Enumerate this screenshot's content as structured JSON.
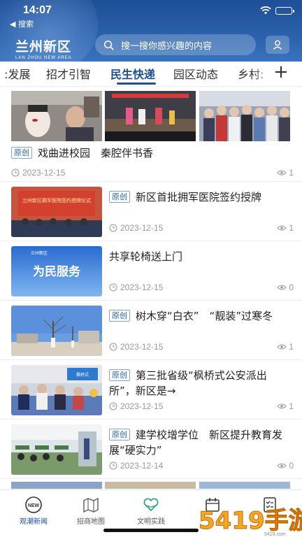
{
  "status_bar": {
    "time": "14:07",
    "back_label": "◀ 搜索"
  },
  "header": {
    "logo_main": "兰州新区",
    "logo_sub": "LAN ZHOU NEW AREA",
    "search_placeholder": "搜一搜你感兴趣的内容",
    "accent_color": "#1e4f97"
  },
  "tabs": {
    "items": [
      {
        "label": ":发展"
      },
      {
        "label": "招才引智"
      },
      {
        "label": "民生快递",
        "active": true
      },
      {
        "label": "园区动态"
      },
      {
        "label": "乡村:"
      }
    ],
    "add_label": "+"
  },
  "feed": {
    "featured": {
      "tag": "原创",
      "title": "戏曲进校园　秦腔伴书香",
      "date": "2023-12-15",
      "views": "1"
    },
    "items": [
      {
        "tag": "原创",
        "title": "新区首批拥军医院签约授牌",
        "date": "2023-12-15",
        "views": "1",
        "thumb_text": "兰州新区拥军医院签约授牌仪式"
      },
      {
        "tag": "",
        "title": "共享轮椅送上门",
        "date": "2023-12-15",
        "views": "0",
        "thumb_text": "为民服务",
        "thumb_brand": "兰州新区"
      },
      {
        "tag": "原创",
        "title": "树木穿“白衣”　“靓装”过寒冬",
        "date": "2023-12-15",
        "views": "1"
      },
      {
        "tag": "原创",
        "title": "第三批省级“枫桥式公安派出所”，新区是→",
        "date": "2023-12-15",
        "views": "1",
        "thumb_text": "枫桥式"
      },
      {
        "tag": "原创",
        "title": "建学校增学位　新区提升教育发展“硬实力”",
        "date": "2023-12-14",
        "views": "0"
      }
    ]
  },
  "bottom_nav": {
    "items": [
      {
        "label": "观潮新闻",
        "icon": "new-badge-icon",
        "active": true
      },
      {
        "label": "招商地图",
        "icon": "map-icon"
      },
      {
        "label": "文明实践",
        "icon": "heart-hands-icon"
      },
      {
        "label": "",
        "icon": "calendar-icon"
      },
      {
        "label": "",
        "icon": "checklist-icon"
      }
    ]
  },
  "watermark": {
    "text": "5419手游网",
    "sub": "5419.com"
  }
}
